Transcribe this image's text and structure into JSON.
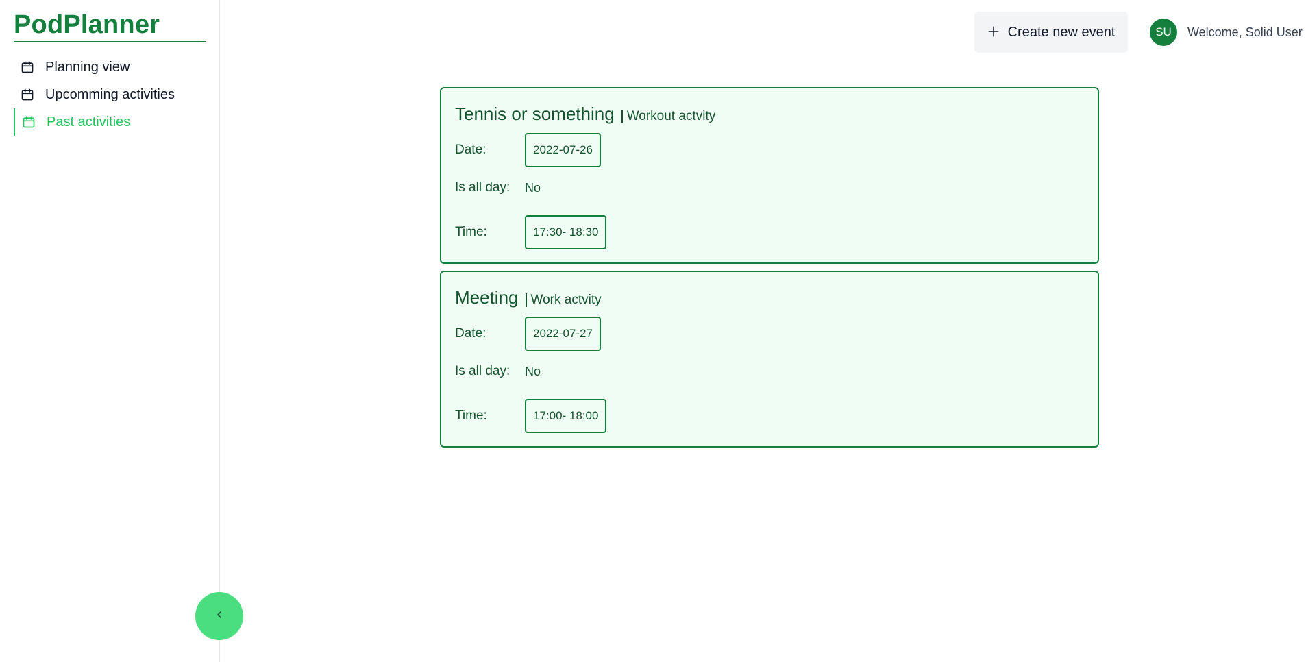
{
  "app": {
    "title": "PodPlanner"
  },
  "sidebar": {
    "items": [
      {
        "label": "Planning view",
        "icon": "calendar-icon",
        "active": false
      },
      {
        "label": "Upcomming activities",
        "icon": "calendar-icon",
        "active": false
      },
      {
        "label": "Past activities",
        "icon": "calendar-icon",
        "active": true
      }
    ],
    "collapse_icon": "chevron-left-icon"
  },
  "header": {
    "create_label": "Create new event",
    "create_icon": "plus-icon",
    "avatar_initials": "SU",
    "welcome": "Welcome, Solid User"
  },
  "events": [
    {
      "title": "Tennis or something",
      "category": "Workout actvity",
      "date_label": "Date:",
      "date": "2022-07-26",
      "allday_label": "Is all day:",
      "allday": "No",
      "time_label": "Time:",
      "time": "17:30- 18:30"
    },
    {
      "title": "Meeting",
      "category": "Work actvity",
      "date_label": "Date:",
      "date": "2022-07-27",
      "allday_label": "Is all day:",
      "allday": "No",
      "time_label": "Time:",
      "time": "17:00- 18:00"
    }
  ],
  "colors": {
    "brand": "#15803d",
    "active": "#22c55e",
    "collapse_button": "#4ade80",
    "card_background": "#f0fdf4",
    "card_text": "#14532d"
  }
}
